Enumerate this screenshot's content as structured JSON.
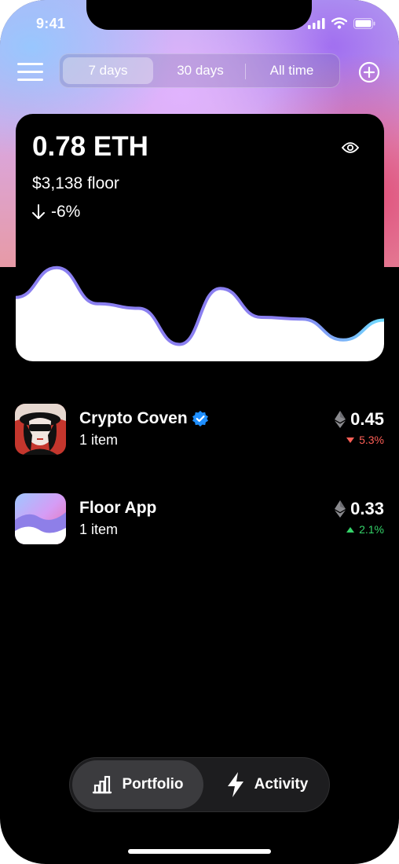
{
  "status_bar": {
    "time": "9:41"
  },
  "top_bar": {
    "segments": [
      {
        "label": "7 days",
        "active": true
      },
      {
        "label": "30 days",
        "active": false
      },
      {
        "label": "All time",
        "active": false
      }
    ],
    "icons": {
      "menu": "hamburger-menu-icon",
      "add": "plus-circle-icon"
    }
  },
  "summary": {
    "balance": "0.78 ETH",
    "floor_value": "$3,138 floor",
    "change": "-6%",
    "change_direction": "down",
    "visibility_icon": "eye-icon"
  },
  "chart_data": {
    "type": "area",
    "series": [
      {
        "values": [
          0.62,
          0.95,
          0.55,
          0.5,
          0.1,
          0.72,
          0.4,
          0.38,
          0.15,
          0.37
        ]
      }
    ],
    "line_colors": [
      "#8a7ff0",
      "#6fdcff"
    ],
    "fill_color": "#ffffff"
  },
  "collections": [
    {
      "name": "Crypto Coven",
      "verified": true,
      "items": "1 item",
      "price": "0.45",
      "change": "5.3%",
      "direction": "down"
    },
    {
      "name": "Floor App",
      "verified": false,
      "items": "1 item",
      "price": "0.33",
      "change": "2.1%",
      "direction": "up"
    }
  ],
  "tab_bar": {
    "tabs": [
      {
        "label": "Portfolio",
        "icon": "bar-chart-icon",
        "active": true
      },
      {
        "label": "Activity",
        "icon": "lightning-icon",
        "active": false
      }
    ]
  },
  "colors": {
    "down": "#ff5f56",
    "up": "#35d46a",
    "verified": "#1f8fff"
  }
}
